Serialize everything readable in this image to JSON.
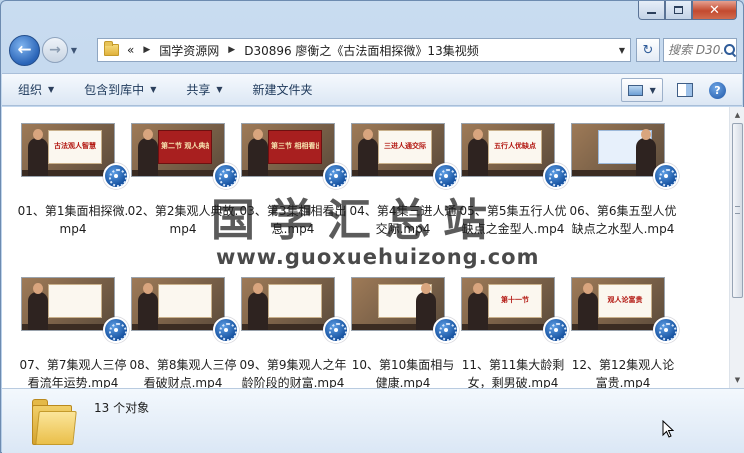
{
  "window": {
    "minimize_icon": "minimize-icon",
    "maximize_icon": "maximize-icon",
    "close_icon": "close-icon",
    "close_label": "✕"
  },
  "nav": {
    "back_icon": "arrow-left-icon",
    "back_label": "←",
    "forward_icon": "arrow-right-icon",
    "forward_label": "→",
    "history_label": "▼",
    "breadcrumb_prefix": "«",
    "breadcrumbs": [
      "国学资源网",
      "D30896 廖衡之《古法面相探微》13集视频"
    ],
    "crumb_separator": "▶",
    "refresh_label": "↻",
    "search_placeholder": "搜索 D30..."
  },
  "toolbar": {
    "organize": "组织",
    "include_in_library": "包含到库中",
    "share": "共享",
    "new_folder": "新建文件夹",
    "dropdown_arrow": "▼"
  },
  "files": [
    {
      "name": "01、第1集面相探微.mp4",
      "board_text": "古法观人智慧",
      "board_style": "white"
    },
    {
      "name": "02、第2集观人典故.mp4",
      "board_text": "第二节 观人典故",
      "board_style": "red"
    },
    {
      "name": "03、第3集相相看出息.mp4",
      "board_text": "第三节 相相看出息",
      "board_style": "red"
    },
    {
      "name": "04、第4集三进人通交际.mp4",
      "board_text": "三进人通交际",
      "board_style": "white"
    },
    {
      "name": "05、第5集五行人优缺点之金型人.mp4",
      "board_text": "五行人优缺点",
      "board_style": "white"
    },
    {
      "name": "06、第6集五型人优缺点之水型人.mp4",
      "board_text": "",
      "board_style": "lblue"
    },
    {
      "name": "07、第7集观人三停看流年运势.mp4",
      "board_text": "",
      "board_style": "white"
    },
    {
      "name": "08、第8集观人三停看破财点.mp4",
      "board_text": "",
      "board_style": "white"
    },
    {
      "name": "09、第9集观人之年龄阶段的财富.mp4",
      "board_text": "",
      "board_style": "white"
    },
    {
      "name": "10、第10集面相与健康.mp4",
      "board_text": "",
      "board_style": "white"
    },
    {
      "name": "11、第11集大龄剩女，剩男破.mp4",
      "board_text": "第十一节",
      "board_style": "white"
    },
    {
      "name": "12、第12集观人论富贵.mp4",
      "board_text": "观人论富贵",
      "board_style": "white"
    }
  ],
  "watermark": {
    "cn": "国学汇总站",
    "en": "www.guoxuehuizong.com"
  },
  "details": {
    "count_label": "13 个对象"
  },
  "scrollbar": {
    "up": "▲",
    "down": "▼"
  }
}
